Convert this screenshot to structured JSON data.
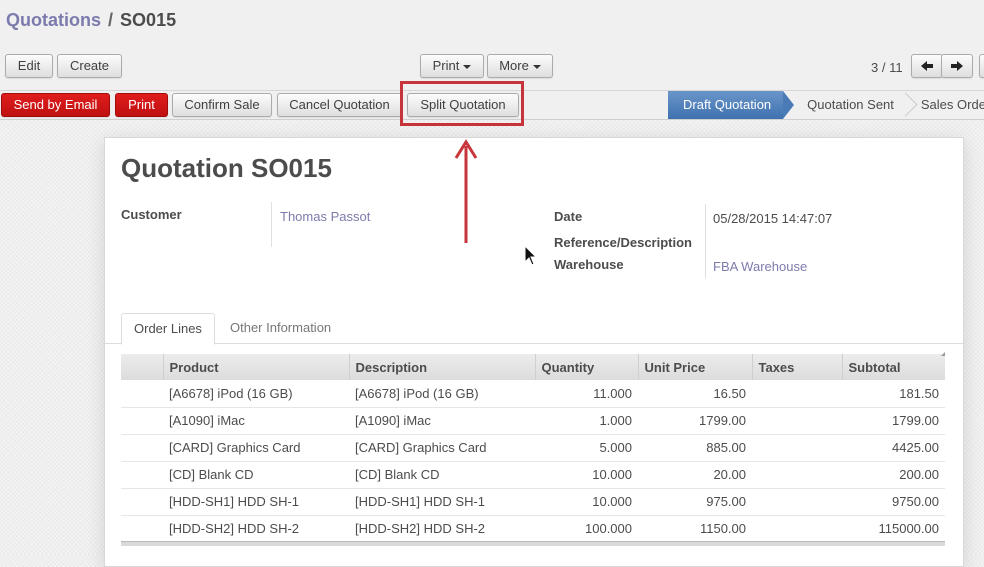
{
  "breadcrumb": {
    "parent": "Quotations",
    "separator": "/",
    "current": "SO015"
  },
  "toolbar": {
    "edit_label": "Edit",
    "create_label": "Create",
    "print_label": "Print",
    "more_label": "More",
    "pager": "3 / 11"
  },
  "actions": {
    "send_email_label": "Send by Email",
    "print_label": "Print",
    "confirm_label": "Confirm Sale",
    "cancel_label": "Cancel Quotation",
    "split_label": "Split Quotation"
  },
  "status_steps": [
    "Draft Quotation",
    "Quotation Sent",
    "Sales Order"
  ],
  "form": {
    "title": "Quotation SO015",
    "customer_label": "Customer",
    "customer_value": "Thomas Passot",
    "date_label": "Date",
    "date_value": "05/28/2015 14:47:07",
    "reference_label": "Reference/Description",
    "warehouse_label": "Warehouse",
    "warehouse_value": "FBA Warehouse"
  },
  "tabs": [
    "Order Lines",
    "Other Information"
  ],
  "order_lines": {
    "columns": [
      "Product",
      "Description",
      "Quantity",
      "Unit Price",
      "Taxes",
      "Subtotal"
    ],
    "rows": [
      [
        "[A6678] iPod (16 GB)",
        "[A6678] iPod (16 GB)",
        "11.000",
        "16.50",
        "",
        "181.50"
      ],
      [
        "[A1090] iMac",
        "[A1090] iMac",
        "1.000",
        "1799.00",
        "",
        "1799.00"
      ],
      [
        "[CARD] Graphics Card",
        "[CARD] Graphics Card",
        "5.000",
        "885.00",
        "",
        "4425.00"
      ],
      [
        "[CD] Blank CD",
        "[CD] Blank CD",
        "10.000",
        "20.00",
        "",
        "200.00"
      ],
      [
        "[HDD-SH1] HDD SH-1",
        "[HDD-SH1] HDD SH-1",
        "10.000",
        "975.00",
        "",
        "9750.00"
      ],
      [
        "[HDD-SH2] HDD SH-2",
        "[HDD-SH2] HDD SH-2",
        "100.000",
        "1150.00",
        "",
        "115000.00"
      ]
    ]
  },
  "colors": {
    "link": "#7c7bad",
    "primary_red": "#d01515",
    "status_active": "#4a7bb7",
    "annotation_red": "#c7343b"
  }
}
